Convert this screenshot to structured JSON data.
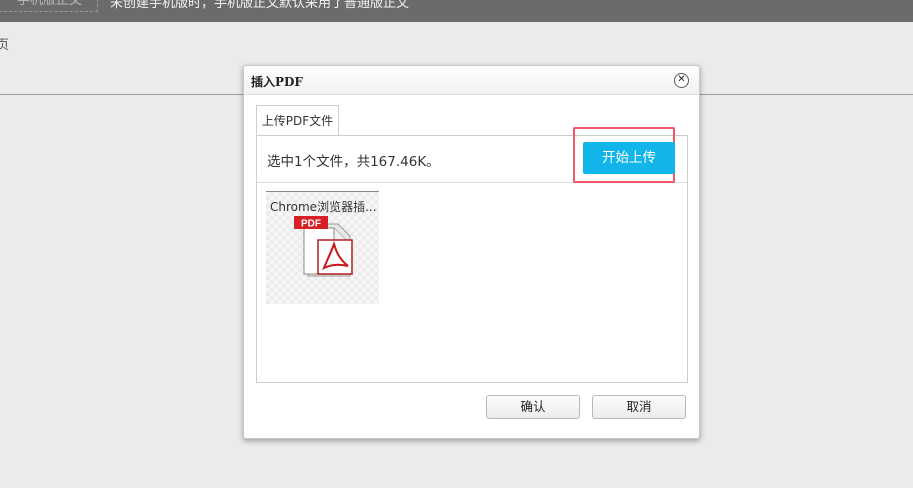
{
  "background": {
    "mobile_button_label": "手机版正文",
    "notice_text": "未创建手机版时，手机版正文默认采用了普通版正文",
    "edge_text": "页"
  },
  "dialog": {
    "title": "插入PDF",
    "close_icon": "close-circle-icon",
    "tab_label": "上传PDF文件",
    "summary": "选中1个文件，共167.46K。",
    "start_upload_label": "开始上传",
    "files": [
      {
        "name": "Chrome浏览器插...",
        "icon": "pdf-file-icon"
      }
    ],
    "ok_label": "确认",
    "cancel_label": "取消"
  },
  "colors": {
    "accent": "#12b5ea",
    "highlight": "#f0566c",
    "topbar": "#6b6b6b"
  }
}
